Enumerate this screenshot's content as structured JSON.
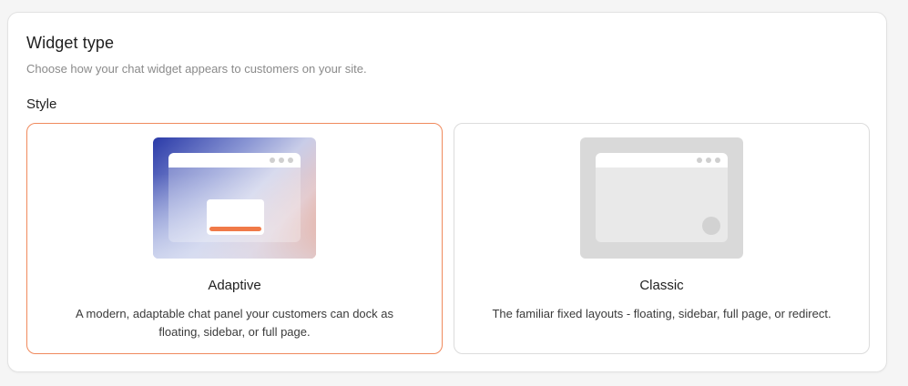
{
  "section": {
    "title": "Widget type",
    "subtitle": "Choose how your chat widget appears to customers on your site.",
    "style_label": "Style"
  },
  "options": [
    {
      "name": "Adaptive",
      "description": "A modern, adaptable chat panel your customers can dock as floating, sidebar, or full page.",
      "selected": true,
      "preview_icon": "adaptive-preview-icon"
    },
    {
      "name": "Classic",
      "description": "The familiar fixed layouts - floating, sidebar, full page, or redirect.",
      "selected": false,
      "preview_icon": "classic-preview-icon"
    }
  ],
  "colors": {
    "accent": "#f07a48",
    "selected_border": "#f08a5d",
    "gradient_start": "#2a3aa8"
  }
}
